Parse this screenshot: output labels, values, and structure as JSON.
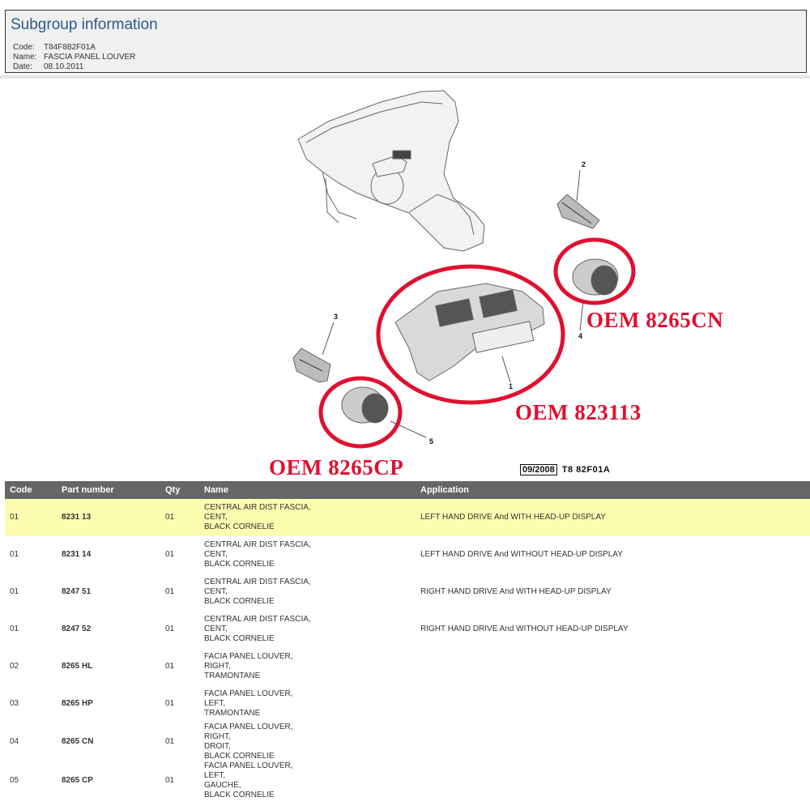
{
  "subgroup": {
    "title": "Subgroup information",
    "fields": [
      {
        "key": "Code:",
        "value": "T84F882F01A"
      },
      {
        "key": "Name:",
        "value": "FASCIA PANEL LOUVER"
      },
      {
        "key": "Date:",
        "value": "08.10.2011"
      }
    ]
  },
  "diagram": {
    "callouts": [
      "1",
      "2",
      "3",
      "4",
      "5"
    ],
    "oem_labels": {
      "cn": "OEM 8265CN",
      "main": "OEM 823113",
      "cp": "OEM 8265CP"
    },
    "date_stamp": "09/2008",
    "ref_code": "T8 82F01A",
    "colors": {
      "highlight": "#e01030",
      "line": "#555555",
      "fill": "#e8e8e8"
    }
  },
  "table": {
    "headers": [
      "Code",
      "Part number",
      "Qty",
      "Name",
      "Application"
    ],
    "rows": [
      {
        "code": "01",
        "part_number": "8231 13",
        "qty": "01",
        "name": [
          "CENTRAL AIR DIST FASCIA,",
          "CENT,",
          "BLACK CORNELIE"
        ],
        "application": "LEFT HAND DRIVE And WITH HEAD-UP DISPLAY",
        "highlighted": true
      },
      {
        "code": "01",
        "part_number": "8231 14",
        "qty": "01",
        "name": [
          "CENTRAL AIR DIST FASCIA,",
          "CENT,",
          "BLACK CORNELIE"
        ],
        "application": "LEFT HAND DRIVE And WITHOUT HEAD-UP DISPLAY",
        "highlighted": false
      },
      {
        "code": "01",
        "part_number": "8247 51",
        "qty": "01",
        "name": [
          "CENTRAL AIR DIST FASCIA,",
          "CENT,",
          "BLACK CORNELIE"
        ],
        "application": "RIGHT HAND DRIVE And WITH HEAD-UP DISPLAY",
        "highlighted": false
      },
      {
        "code": "01",
        "part_number": "8247 52",
        "qty": "01",
        "name": [
          "CENTRAL AIR DIST FASCIA,",
          "CENT,",
          "BLACK CORNELIE"
        ],
        "application": "RIGHT HAND DRIVE And WITHOUT HEAD-UP DISPLAY",
        "highlighted": false
      },
      {
        "code": "02",
        "part_number": "8265 HL",
        "qty": "01",
        "name": [
          "FACIA PANEL LOUVER,",
          "RIGHT,",
          "TRAMONTANE"
        ],
        "application": "",
        "highlighted": false
      },
      {
        "code": "03",
        "part_number": "8265 HP",
        "qty": "01",
        "name": [
          "FACIA PANEL LOUVER,",
          "LEFT,",
          "TRAMONTANE"
        ],
        "application": "",
        "highlighted": false
      },
      {
        "code": "04",
        "part_number": "8265 CN",
        "qty": "01",
        "name": [
          "FACIA PANEL LOUVER,",
          "RIGHT,",
          "DROIT,",
          "BLACK CORNELIE"
        ],
        "application": "",
        "highlighted": false
      },
      {
        "code": "05",
        "part_number": "8265 CP",
        "qty": "01",
        "name": [
          "FACIA PANEL LOUVER,",
          "LEFT,",
          "GAUCHE,",
          "BLACK CORNELIE"
        ],
        "application": "",
        "highlighted": false
      }
    ]
  }
}
